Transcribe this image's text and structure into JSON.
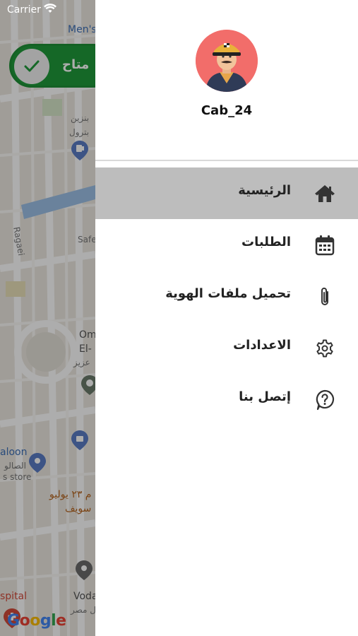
{
  "status_bar": {
    "carrier": "Carrier"
  },
  "availability": {
    "label": "متاح",
    "status": "on"
  },
  "map": {
    "labels": {
      "mens": "Men's",
      "fuel1": "بنزين",
      "fuel2": "بترول",
      "safe": "Safe",
      "ragaei": "Ragaei",
      "om": "Om",
      "el": "El-",
      "aziz": "عزيز",
      "saloon": "aloon",
      "saloon_ar": "الصالو",
      "store": "s store",
      "july": "م ٢٣ يوليو",
      "suez": "سويف",
      "hospital": "spital",
      "voda": "Voda",
      "misr": "ل مصر",
      "google": "Google"
    }
  },
  "drawer": {
    "username": "Cab_24",
    "menu": [
      {
        "label": "الرئيسية",
        "icon": "home-icon",
        "active": true
      },
      {
        "label": "الطلبات",
        "icon": "calendar-icon",
        "active": false
      },
      {
        "label": "تحميل ملفات الهوية",
        "icon": "paperclip-icon",
        "active": false
      },
      {
        "label": "الاعدادات",
        "icon": "gear-icon",
        "active": false
      },
      {
        "label": "إتصل بنا",
        "icon": "help-icon",
        "active": false
      }
    ]
  },
  "colors": {
    "accent_green": "#1f9a3a",
    "active_row": "#bdbdbd",
    "avatar_bg": "#f26d6a"
  }
}
